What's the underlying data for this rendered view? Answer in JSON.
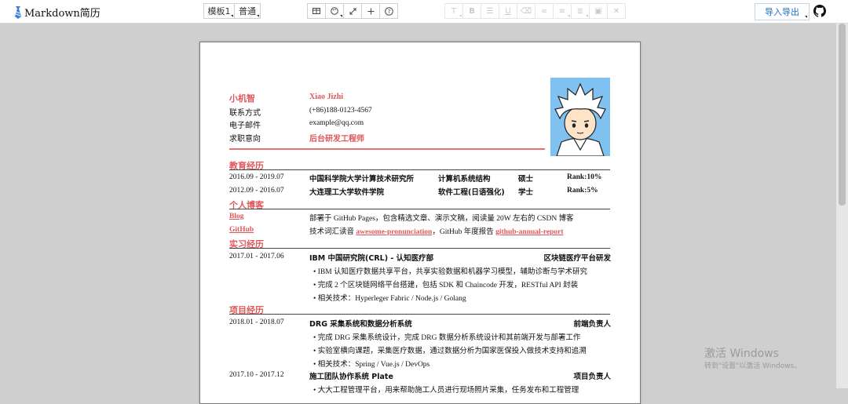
{
  "app": {
    "title": "Markdown简历"
  },
  "toolbar": {
    "template_label": "模板1",
    "style_label": "普通",
    "tools": [
      "table-icon",
      "palette-icon",
      "expand-icon",
      "plus-icon",
      "help-icon"
    ],
    "format_tools": [
      "heading-icon",
      "bold-icon",
      "list-icon",
      "underline-icon",
      "eraser-icon",
      "link-icon",
      "align-left-icon",
      "align-justify-icon",
      "image-icon",
      "close-icon"
    ],
    "import_export_label": "导入导出"
  },
  "resume": {
    "name_cn": "小机智",
    "name_en": "Xiao Jizhi",
    "contact_label": "联系方式",
    "contact_value": "(+86)188-0123-4567",
    "email_label": "电子邮件",
    "email_value": "example@qq.com",
    "intent_label": "求职意向",
    "intent_value": "后台研发工程师",
    "sections": {
      "education": "教育经历",
      "blog": "个人博客",
      "internship": "实习经历",
      "projects": "项目经历"
    },
    "education": [
      {
        "dates": "2016.09 - 2019.07",
        "school": "中国科学院大学计算技术研究所",
        "major": "计算机系统结构",
        "degree": "硕士",
        "rank": "Rank:10%"
      },
      {
        "dates": "2012.09 - 2016.07",
        "school": "大连理工大学软件学院",
        "major": "软件工程(日语强化)",
        "degree": "学士",
        "rank": "Rank:5%"
      }
    ],
    "blog": {
      "blog_label": "Blog",
      "github_label": "GitHub",
      "line1": "部署于 GitHub Pages，包含精选文章、演示文稿，阅读量 20W 左右的 CSDN 博客",
      "line2_a": "技术词汇读音",
      "line2_link1": "awesome-pronunciation",
      "line2_b": "，GitHub 年度报告",
      "line2_link2": "github-annual-report"
    },
    "internship": {
      "dates": "2017.01 - 2017.06",
      "title": "IBM 中国研究院(CRL) - 认知医疗部",
      "role": "区块链医疗平台研发",
      "bullets": [
        "IBM 认知医疗数据共享平台，共享实验数据和机器学习模型，辅助诊断与学术研究",
        "完成 2 个区块链网络平台搭建，包括 SDK 和 Chaincode 开发，RESTful API 封装",
        "相关技术：Hyperleger Fabric / Node.js / Golang"
      ]
    },
    "projects": [
      {
        "dates": "2018.01 - 2018.07",
        "title": "DRG 采集系统和数据分析系统",
        "role": "前端负责人",
        "bullets": [
          "完成 DRG 采集系统设计，完成 DRG 数据分析系统设计和其前端开发与部署工作",
          "实验室横向课题，采集医疗数据，通过数据分析为国家医保投入做技术支持和追溯",
          "相关技术：Spring / Vue.js / DevOps"
        ]
      },
      {
        "dates": "2017.10 - 2017.12",
        "title": "施工团队协作系统 Plate",
        "role": "项目负责人",
        "bullets": [
          "大大工程管理平台，用来帮助施工人员进行现场照片采集，任务发布和工程管理"
        ]
      }
    ]
  },
  "watermark": {
    "line1": "激活 Windows",
    "line2": "转到\"设置\"以激活 Windows。"
  }
}
